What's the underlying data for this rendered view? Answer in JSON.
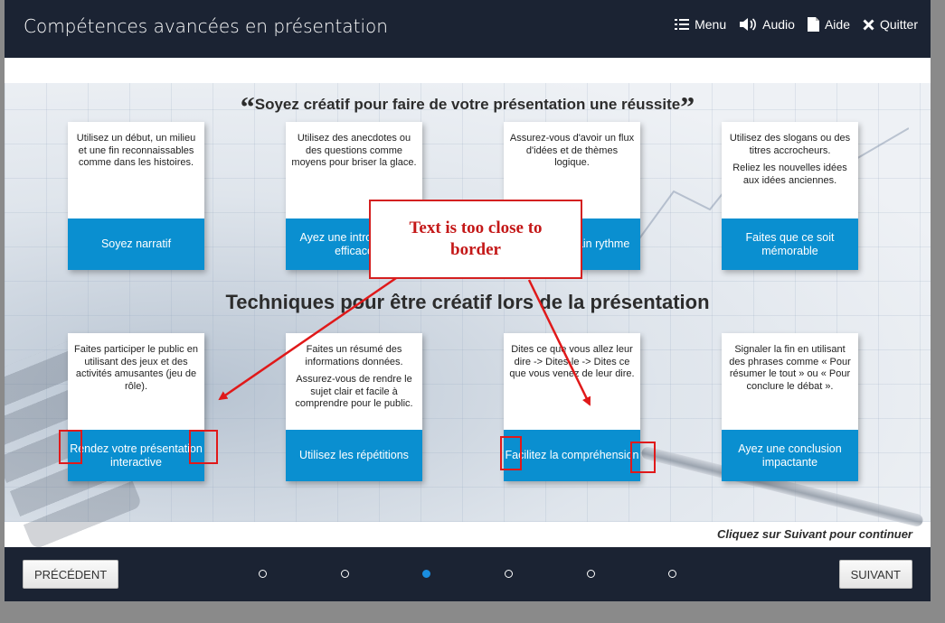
{
  "header": {
    "title": "Compétences avancées en présentation",
    "nav": [
      {
        "label": "Menu",
        "icon": "menu-list-icon"
      },
      {
        "label": "Audio",
        "icon": "speaker-icon"
      },
      {
        "label": "Aide",
        "icon": "document-icon"
      },
      {
        "label": "Quitter",
        "icon": "close-x-icon"
      }
    ]
  },
  "quote": {
    "open": "“",
    "text": "Soyez créatif pour faire de votre présentation une réussite",
    "close": "”"
  },
  "section_title": "Techniques pour être créatif lors de la présentation",
  "cards_top": [
    {
      "desc": [
        "Utilisez un début, un milieu et une fin reconnaissables comme dans les histoires."
      ],
      "button": "Soyez narratif"
    },
    {
      "desc": [
        "Utilisez des anecdotes ou des questions comme moyens pour briser la glace."
      ],
      "button": "Ayez une introduction efficace"
    },
    {
      "desc": [
        "Assurez-vous d'avoir un flux d'idées et de thèmes logique."
      ],
      "button": "Ayez un certain rythme"
    },
    {
      "desc": [
        "Utilisez des slogans ou des titres accrocheurs.",
        "Reliez les nouvelles idées aux idées anciennes."
      ],
      "button": "Faites que ce soit mémorable"
    }
  ],
  "cards_bottom": [
    {
      "desc": [
        "Faites participer le public en utilisant des jeux et des activités amusantes (jeu de rôle)."
      ],
      "button": "Rendez votre présentation interactive"
    },
    {
      "desc": [
        "Faites un résumé des informations données.",
        "Assurez-vous de rendre le sujet clair et facile à comprendre pour le public."
      ],
      "button": "Utilisez les répétitions"
    },
    {
      "desc": [
        "Dites ce que vous allez leur dire -> Dites-le -> Dites ce que vous venez de leur dire."
      ],
      "button": "Facilitez la compréhension"
    },
    {
      "desc": [
        "Signaler la fin en utilisant des phrases comme « Pour résumer le tout » ou « Pour conclure le débat »."
      ],
      "button": "Ayez une conclusion impactante"
    }
  ],
  "continue_hint": "Cliquez sur Suivant pour continuer",
  "footer": {
    "prev_label": "PRÉCÉDENT",
    "next_label": "SUIVANT",
    "dots_total": 6,
    "dots_active_index": 2
  },
  "annotation": {
    "callout_text_line1": "Text is too close to",
    "callout_text_line2": "border",
    "color": "#e0191a"
  },
  "colors": {
    "header_bg": "#1b2333",
    "button_blue": "#0a8fd0",
    "active_dot": "#1a8ee0"
  }
}
